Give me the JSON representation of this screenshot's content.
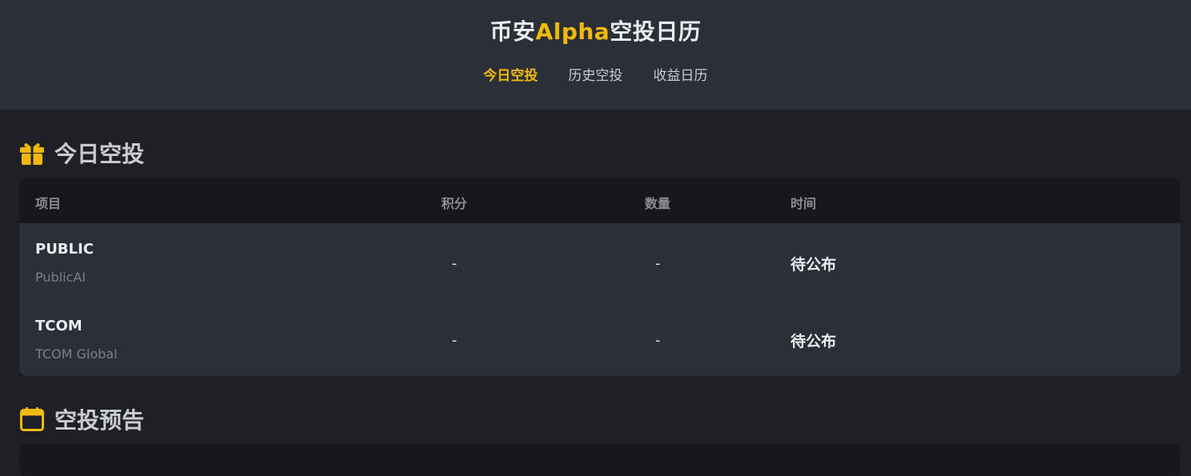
{
  "header": {
    "title_prefix": "币安",
    "title_accent": "Alpha",
    "title_suffix": "空投日历",
    "nav": [
      {
        "label": "今日空投",
        "active": true
      },
      {
        "label": "历史空投",
        "active": false
      },
      {
        "label": "收益日历",
        "active": false
      }
    ]
  },
  "today": {
    "heading": "今日空投",
    "icon": "gift-icon",
    "columns": [
      "项目",
      "积分",
      "数量",
      "时间"
    ],
    "rows": [
      {
        "symbol": "PUBLIC",
        "name": "PublicAI",
        "points": "-",
        "amount": "-",
        "time": "待公布"
      },
      {
        "symbol": "TCOM",
        "name": "TCOM Global",
        "points": "-",
        "amount": "-",
        "time": "待公布"
      }
    ]
  },
  "preview": {
    "heading": "空投预告",
    "icon": "calendar-icon"
  },
  "colors": {
    "accent": "#f0b90b",
    "background": "#1e2026",
    "panel": "#2b2f37",
    "table_head": "#16181c"
  }
}
